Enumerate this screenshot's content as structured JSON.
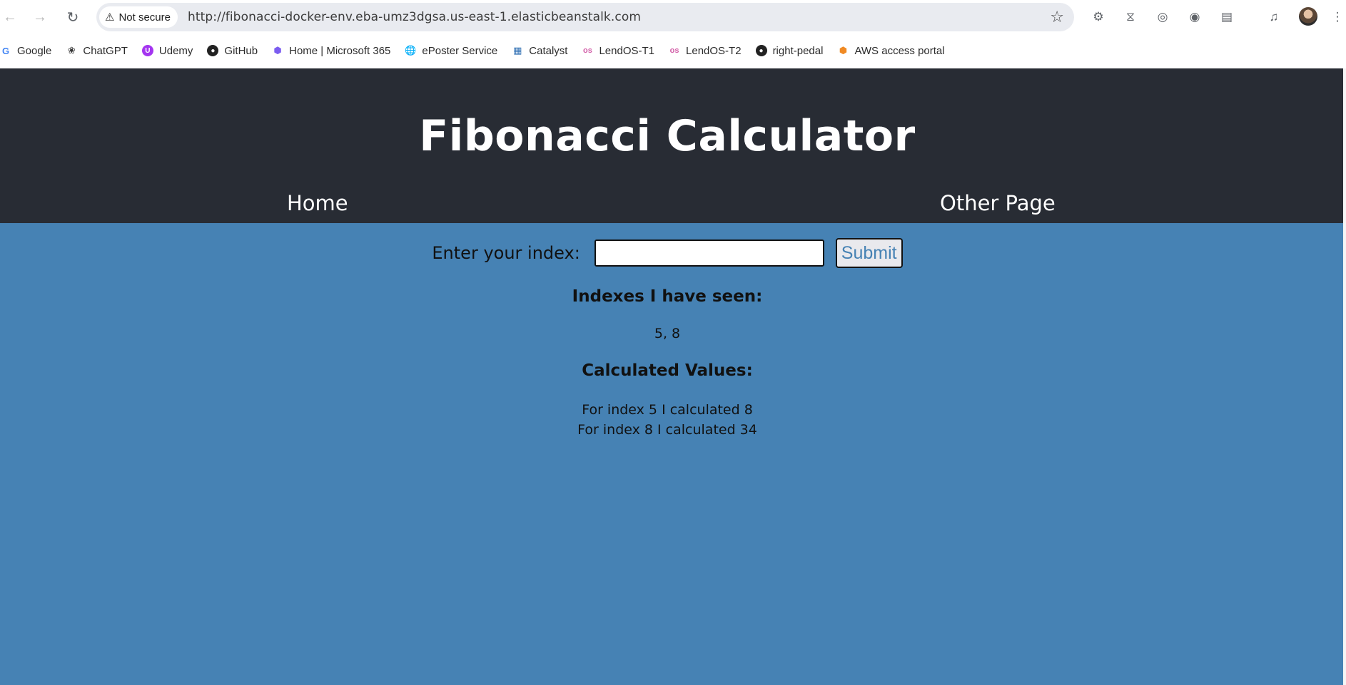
{
  "browser": {
    "security_label": "Not secure",
    "url": "http://fibonacci-docker-env.eba-umz3dgsa.us-east-1.elasticbeanstalk.com",
    "bookmarks": [
      {
        "label": "Google",
        "icon": "google-icon"
      },
      {
        "label": "ChatGPT",
        "icon": "chatgpt-icon"
      },
      {
        "label": "Udemy",
        "icon": "udemy-icon"
      },
      {
        "label": "GitHub",
        "icon": "github-icon"
      },
      {
        "label": "Home | Microsoft 365",
        "icon": "microsoft365-icon"
      },
      {
        "label": "ePoster Service",
        "icon": "globe-icon"
      },
      {
        "label": "Catalyst",
        "icon": "catalyst-icon"
      },
      {
        "label": "LendOS-T1",
        "icon": "lendos-icon"
      },
      {
        "label": "LendOS-T2",
        "icon": "lendos-icon"
      },
      {
        "label": "right-pedal",
        "icon": "github-icon"
      },
      {
        "label": "AWS access portal",
        "icon": "aws-icon"
      }
    ]
  },
  "app": {
    "title": "Fibonacci Calculator",
    "nav": {
      "home": "Home",
      "other": "Other Page"
    },
    "form": {
      "label": "Enter your index:",
      "input_value": "",
      "submit_label": "Submit"
    },
    "seen_heading": "Indexes I have seen:",
    "seen_values": "5, 8",
    "calc_heading": "Calculated Values:",
    "calculated": [
      "For index 5 I calculated 8",
      "For index 8 I calculated 34"
    ]
  },
  "colors": {
    "header_bg": "#282c34",
    "page_bg": "#4682b4",
    "submit_text": "#4682b4"
  }
}
